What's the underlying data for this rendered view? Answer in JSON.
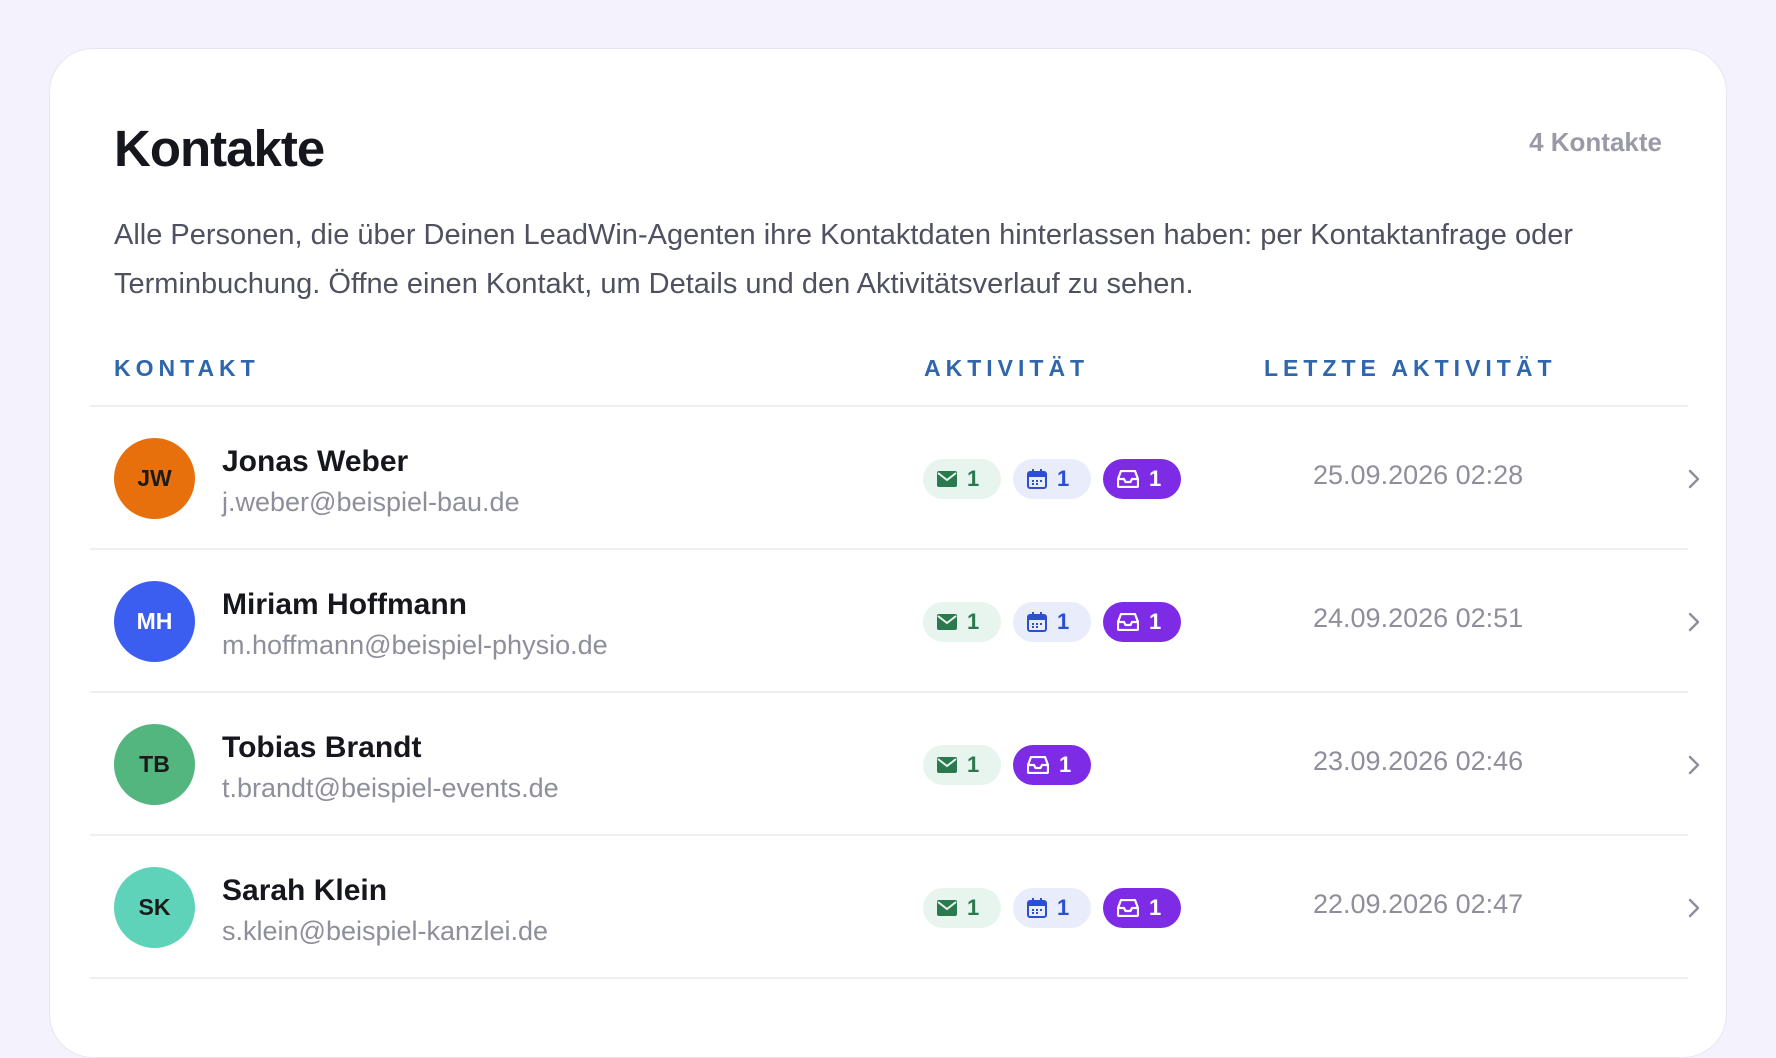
{
  "header": {
    "title": "Kontakte",
    "count": "4 Kontakte",
    "description": "Alle Personen, die über Deinen LeadWin-Agenten ihre Kontaktdaten hinterlassen haben: per Kontaktanfrage oder Terminbuchung. Öffne einen Kontakt, um Details und den Aktivitätsverlauf zu sehen."
  },
  "table": {
    "headers": {
      "contact": "Kontakt",
      "activity": "Aktivität",
      "last_activity": "Letzte Aktivität"
    },
    "rows": [
      {
        "initials": "JW",
        "name": "Jonas Weber",
        "email": "j.weber@beispiel-bau.de",
        "avatar_bg": "#e8700c",
        "avatar_fg": "#1b1b1b",
        "mail": "1",
        "calendar": "1",
        "inbox": "1",
        "last_activity": "25.09.2026 02:28"
      },
      {
        "initials": "MH",
        "name": "Miriam Hoffmann",
        "email": "m.hoffmann@beispiel-physio.de",
        "avatar_bg": "#3c5ef0",
        "avatar_fg": "#ffffff",
        "mail": "1",
        "calendar": "1",
        "inbox": "1",
        "last_activity": "24.09.2026 02:51"
      },
      {
        "initials": "TB",
        "name": "Tobias Brandt",
        "email": "t.brandt@beispiel-events.de",
        "avatar_bg": "#52b67e",
        "avatar_fg": "#1b1b1b",
        "mail": "1",
        "calendar": null,
        "inbox": "1",
        "last_activity": "23.09.2026 02:46"
      },
      {
        "initials": "SK",
        "name": "Sarah Klein",
        "email": "s.klein@beispiel-kanzlei.de",
        "avatar_bg": "#5fd3b9",
        "avatar_fg": "#1b1b1b",
        "mail": "1",
        "calendar": "1",
        "inbox": "1",
        "last_activity": "22.09.2026 02:47"
      }
    ]
  },
  "icons": {
    "mail": "mail-icon",
    "calendar": "calendar-icon",
    "inbox": "inbox-icon",
    "chevron": "chevron-right-icon"
  },
  "colors": {
    "accent_header": "#2f66ac",
    "inbox_badge": "#7d2be4",
    "mail_badge_bg": "#e7f5ee",
    "calendar_badge_bg": "#e9edfb"
  }
}
